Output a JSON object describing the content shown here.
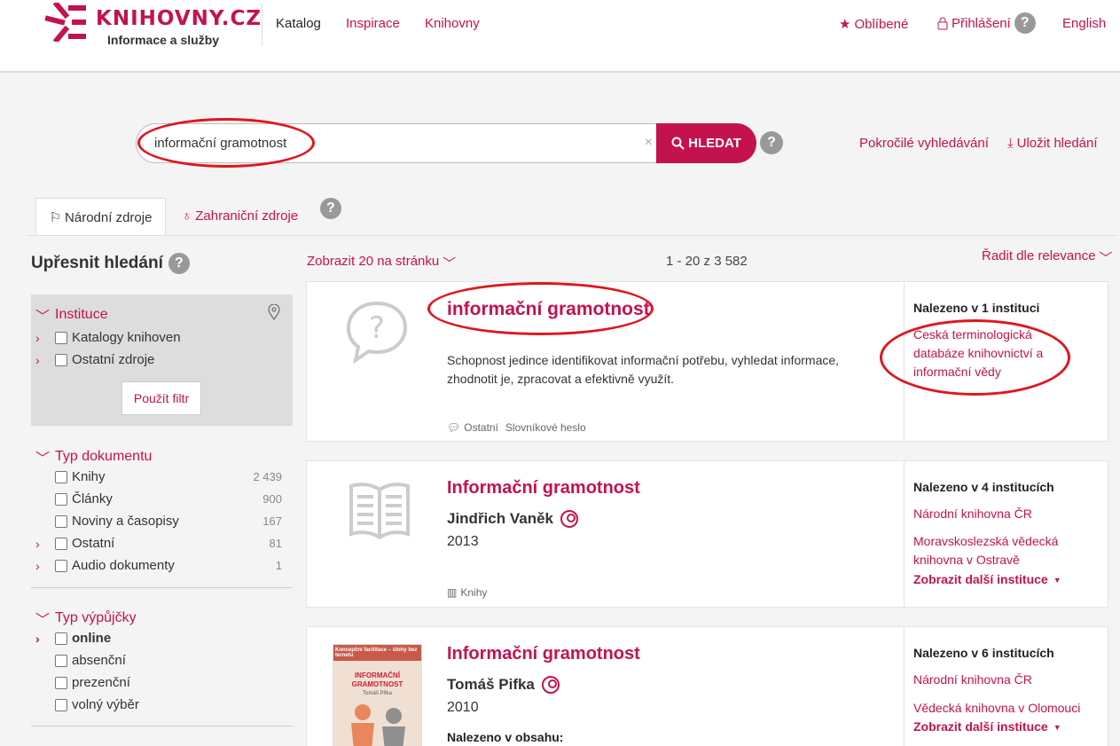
{
  "header": {
    "logo_text": "KNIHOVNY.CZ",
    "logo_sub": "Informace a služby",
    "nav": [
      "Katalog",
      "Inspirace",
      "Knihovny"
    ],
    "favorites": "Oblíbené",
    "login": "Přihlášení",
    "language": "English",
    "help": "?"
  },
  "search": {
    "value": "informační gramotnost",
    "clear": "×",
    "button": "HLEDAT",
    "help": "?",
    "advanced": "Pokročilé vyhledávání",
    "save": "Uložit hledání"
  },
  "tabs": {
    "national": "Národní zdroje",
    "foreign": "Zahraniční zdroje",
    "help": "?"
  },
  "sidebar": {
    "title": "Upřesnit hledání",
    "help": "?",
    "institution": {
      "heading": "Instituce",
      "items": [
        "Katalogy knihoven",
        "Ostatní zdroje"
      ],
      "apply": "Použít filtr"
    },
    "doctype": {
      "heading": "Typ dokumentu",
      "items": [
        {
          "label": "Knihy",
          "count": "2 439"
        },
        {
          "label": "Články",
          "count": "900"
        },
        {
          "label": "Noviny a časopisy",
          "count": "167"
        },
        {
          "label": "Ostatní",
          "count": "81"
        },
        {
          "label": "Audio dokumenty",
          "count": "1"
        }
      ]
    },
    "loan": {
      "heading": "Typ výpůjčky",
      "items": [
        "online",
        "absenční",
        "prezenční",
        "volný výběr"
      ]
    }
  },
  "results": {
    "per_page": "Zobrazit 20 na stránku",
    "range": "1 - 20 z 3 582",
    "sort": "Řadit dle relevance",
    "items": [
      {
        "title": "informační gramotnost",
        "description": "Schopnost jedince identifikovat informační potřebu, vyhledat informace, zhodnotit je, zpracovat a efektivně využít.",
        "type_a": "Ostatní",
        "type_b": "Slovníkové heslo",
        "found": "Nalezeno v 1 instituci",
        "links": [
          "Česká terminologická databáze knihovnictví a informační vědy"
        ]
      },
      {
        "title": "Informační gramotnost",
        "author": "Jindřich Vaněk",
        "year": "2013",
        "type_a": "Knihy",
        "found": "Nalezeno v 4 institucích",
        "links": [
          "Národní knihovna ČR",
          "Moravskoslezská vědecká knihovna v Ostravě"
        ],
        "more": "Zobrazit další instituce"
      },
      {
        "title": "Informační gramotnost",
        "author": "Tomáš Pifka",
        "year": "2010",
        "found_in_content": "Nalezeno v obsahu:",
        "found": "Nalezeno v 6 institucích",
        "links": [
          "Národní knihovna ČR",
          "Vědecká knihovna v Olomouci"
        ],
        "more": "Zobrazit další instituce",
        "cover_top": "Koncepční facilitace – úlohy bez ternetu",
        "cover_title": "INFORMAČNÍ GRAMOTNOST",
        "cover_author": "Tomáš Pifka"
      }
    ]
  },
  "colors": {
    "accent": "#c4124f",
    "annotation": "#e0161e"
  }
}
